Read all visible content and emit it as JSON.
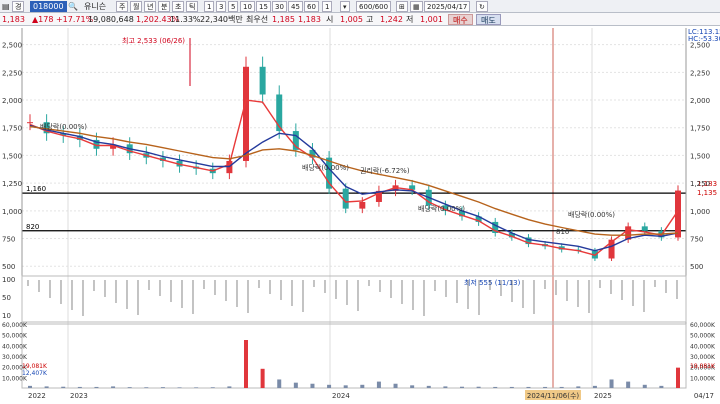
{
  "toolbar": {
    "menu_icon": "menu-icon",
    "left_label": "경",
    "code": "018000",
    "name": "유니슨",
    "periods": [
      "주",
      "월",
      "년",
      "분",
      "초",
      "틱"
    ],
    "intervals": [
      "1",
      "3",
      "5",
      "10",
      "15",
      "30",
      "45",
      "60",
      "1"
    ],
    "count": "600/600",
    "date": "2025/04/17"
  },
  "quote": {
    "price": "1,183",
    "change": "▲178 +17.71%",
    "volume": "19,080,648",
    "vol_ratio": "1,202.43%",
    "turnover": "11.33%",
    "amount": "22,340백만",
    "best_ask_label": "최우선",
    "best_ask": "1,185",
    "best_bid": "1,183",
    "open_label": "시",
    "open": "1,005",
    "high_label": "고",
    "high": "1,242",
    "low_label": "저",
    "low": "1,001",
    "sell_label": "매수",
    "buy_label": "매도"
  },
  "chart_data": {
    "type": "line",
    "subtype": "candlestick-with-moving-averages",
    "x_ticks": [
      "2022",
      "2023",
      "2024",
      "2024/11/06(수)",
      "2025",
      "04/17"
    ],
    "y_ticks": [
      "2,500",
      "2,250",
      "2,000",
      "1,750",
      "1,500",
      "1,250",
      "1,000",
      "750",
      "500"
    ],
    "ylim": [
      430,
      2650
    ],
    "price_series": {
      "dates": [
        "2022-01",
        "2022-02",
        "2022-03",
        "2022-04",
        "2022-05",
        "2022-06",
        "2022-07",
        "2022-08",
        "2022-09",
        "2022-10",
        "2022-11",
        "2022-12",
        "2023-01",
        "2023-02",
        "2023-03",
        "2023-04",
        "2023-05",
        "2023-06",
        "2023-07",
        "2023-08",
        "2023-09",
        "2023-10",
        "2023-11",
        "2023-12",
        "2024-01",
        "2024-02",
        "2024-03",
        "2024-04",
        "2024-05",
        "2024-06",
        "2024-07",
        "2024-08",
        "2024-09",
        "2024-10",
        "2024-11",
        "2024-12",
        "2025-01",
        "2025-02",
        "2025-03",
        "2025-04"
      ],
      "close": [
        1800,
        1700,
        1680,
        1640,
        1560,
        1600,
        1520,
        1480,
        1450,
        1400,
        1380,
        1340,
        1450,
        2300,
        2050,
        1720,
        1550,
        1480,
        1200,
        1020,
        1080,
        1180,
        1230,
        1190,
        1050,
        1000,
        950,
        900,
        800,
        760,
        700,
        680,
        650,
        640,
        570,
        740,
        860,
        820,
        760,
        1183
      ]
    },
    "ma_series": [
      {
        "color": "#e83a3a",
        "values": [
          1780,
          1720,
          1680,
          1650,
          1590,
          1590,
          1540,
          1500,
          1460,
          1420,
          1390,
          1360,
          1420,
          2000,
          1980,
          1760,
          1580,
          1480,
          1250,
          1080,
          1090,
          1160,
          1210,
          1190,
          1080,
          1010,
          960,
          910,
          820,
          770,
          710,
          690,
          660,
          640,
          600,
          720,
          830,
          810,
          780,
          1000
        ]
      },
      {
        "color": "#243a9c",
        "values": [
          1770,
          1730,
          1700,
          1670,
          1620,
          1600,
          1560,
          1530,
          1490,
          1460,
          1430,
          1400,
          1400,
          1520,
          1620,
          1700,
          1680,
          1560,
          1380,
          1220,
          1150,
          1170,
          1190,
          1180,
          1120,
          1060,
          1000,
          950,
          870,
          800,
          740,
          720,
          700,
          680,
          640,
          680,
          750,
          780,
          770,
          800
        ]
      },
      {
        "color": "#b7631c",
        "values": [
          1760,
          1740,
          1720,
          1700,
          1670,
          1650,
          1620,
          1600,
          1570,
          1540,
          1510,
          1480,
          1470,
          1500,
          1550,
          1560,
          1540,
          1500,
          1450,
          1400,
          1360,
          1330,
          1300,
          1270,
          1230,
          1180,
          1130,
          1080,
          1020,
          970,
          920,
          880,
          850,
          820,
          790,
          780,
          780,
          790,
          790,
          800
        ]
      }
    ],
    "hlines": [
      {
        "label": "1,160",
        "value": 1160
      },
      {
        "label": "820",
        "value": 820
      }
    ],
    "annotations": [
      {
        "text": "최고 2,533 (06/26)",
        "color": "#d0021b"
      },
      {
        "text": "최저 555 (11/13)",
        "color": "#1646b4"
      },
      {
        "text": "배당락(0.00%)",
        "color": "#333"
      },
      {
        "text": "배당락(0.00%)",
        "color": "#333"
      },
      {
        "text": "권리락(-6.72%)",
        "color": "#333"
      },
      {
        "text": "배당락(0.00%)",
        "color": "#333"
      },
      {
        "text": "배당락(0.00%)",
        "color": "#333"
      },
      {
        "text": "810",
        "color": "#333"
      },
      {
        "text": "1,183",
        "color": "#c00"
      },
      {
        "text": "1,135",
        "color": "#c00"
      },
      {
        "text": "LC:113.15",
        "color": "#1646b4"
      },
      {
        "text": "HC:-53.30",
        "color": "#1646b4"
      }
    ],
    "indicator_panel": {
      "y_ticks": [
        "100",
        "50",
        "10"
      ]
    },
    "volume_panel": {
      "y_ticks": [
        "60,000K",
        "50,000K",
        "40,000K",
        "30,000K",
        "20,000K",
        "10,000K"
      ],
      "last_label": "19,081K",
      "secondary_label": "12,407K",
      "values": [
        2,
        1.5,
        1.2,
        1,
        1,
        1.5,
        0.8,
        0.7,
        0.8,
        0.6,
        0.6,
        0.7,
        1.5,
        45,
        18,
        8,
        5,
        4,
        3,
        2.5,
        3,
        6,
        4,
        2.5,
        2,
        1.5,
        1.2,
        1.2,
        1,
        1,
        1,
        1,
        1,
        1.5,
        2,
        8,
        6,
        3,
        2,
        19.081
      ]
    }
  }
}
